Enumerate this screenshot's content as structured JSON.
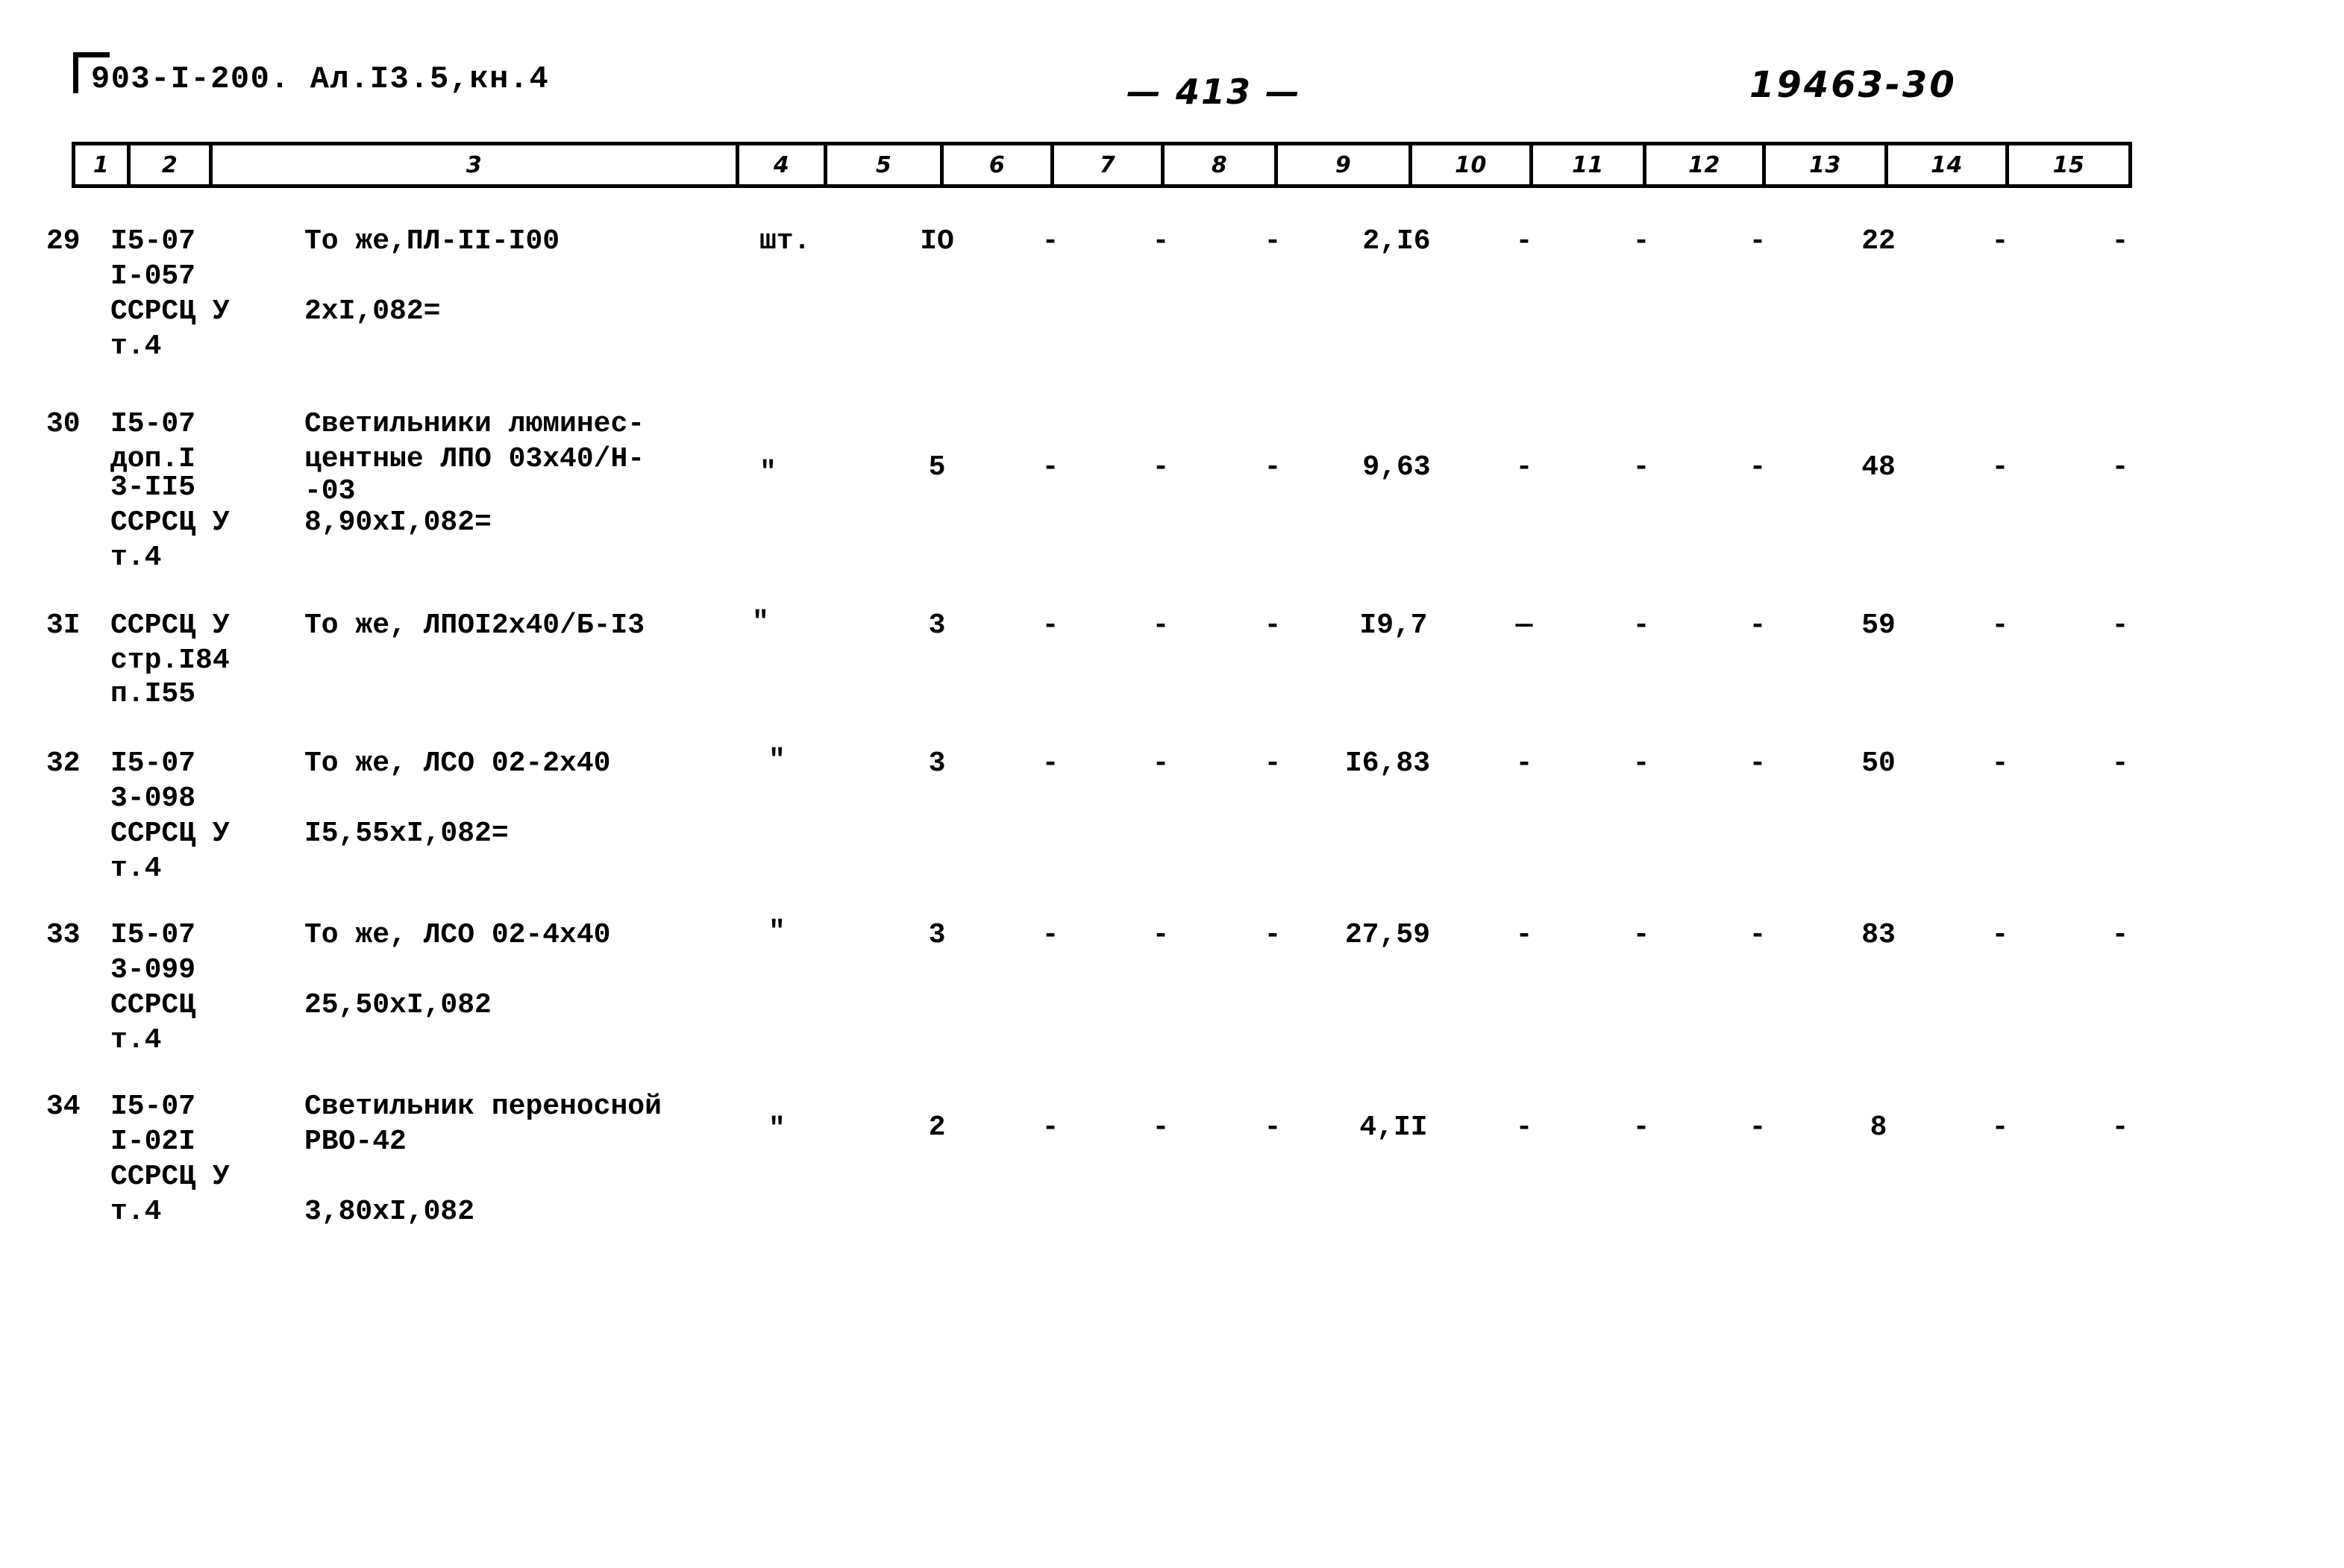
{
  "header": {
    "doc_code": "903-I-200. Ал.I3.5,кн.4",
    "page_number": "— 413 —",
    "archive_code": "19463-30"
  },
  "table": {
    "column_headers": [
      "1",
      "2",
      "3",
      "4",
      "5",
      "6",
      "7",
      "8",
      "9",
      "10",
      "11",
      "12",
      "13",
      "14",
      "15"
    ],
    "rows": [
      {
        "num": "29",
        "code_lines": [
          "I5-07",
          "I-057",
          "ССРСЦ У",
          "т.4"
        ],
        "desc_lines": [
          "То же,ПЛ-II-I00",
          "",
          "2xI,082=",
          ""
        ],
        "unit": "шт.",
        "c5": "IO",
        "c6": "-",
        "c7": "-",
        "c8": "-",
        "c9": "2,I6",
        "c10": "-",
        "c11": "-",
        "c12": "-",
        "c13": "22",
        "c14": "-",
        "c15": "-"
      },
      {
        "num": "30",
        "code_lines": [
          "I5-07",
          "доп.I",
          "3-II5",
          "ССРСЦ У",
          "т.4"
        ],
        "desc_lines": [
          "Светильники люминес-",
          "центные ЛПО 03х40/Н-",
          "-03",
          "8,90хI,082=",
          ""
        ],
        "unit": "\"",
        "c5": "5",
        "c6": "-",
        "c7": "-",
        "c8": "-",
        "c9": "9,63",
        "c10": "-",
        "c11": "-",
        "c12": "-",
        "c13": "48",
        "c14": "-",
        "c15": "-"
      },
      {
        "num": "3I",
        "code_lines": [
          "ССРСЦ У",
          "стр.I84",
          "п.I55"
        ],
        "desc_lines": [
          "То же, ЛПОI2х40/Б-I3",
          "",
          ""
        ],
        "unit": "\"",
        "c5": "3",
        "c6": "-",
        "c7": "-",
        "c8": "-",
        "c9": "I9,7",
        "c10": "—",
        "c11": "-",
        "c12": "-",
        "c13": "59",
        "c14": "-",
        "c15": "-"
      },
      {
        "num": "32",
        "code_lines": [
          "I5-07",
          "3-098",
          "ССРСЦ У",
          "т.4"
        ],
        "desc_lines": [
          "То же, ЛСО 02-2х40",
          "",
          "I5,55хI,082=",
          ""
        ],
        "unit": "\"",
        "c5": "3",
        "c6": "-",
        "c7": "-",
        "c8": "-",
        "c9": "I6,83",
        "c10": "-",
        "c11": "-",
        "c12": "-",
        "c13": "50",
        "c14": "-",
        "c15": "-"
      },
      {
        "num": "33",
        "code_lines": [
          "I5-07",
          "3-099",
          "ССРСЦ",
          "т.4"
        ],
        "desc_lines": [
          "То же, ЛСО 02-4х40",
          "",
          "25,50хI,082",
          ""
        ],
        "unit": "\"",
        "c5": "3",
        "c6": "-",
        "c7": "-",
        "c8": "-",
        "c9": "27,59",
        "c10": "-",
        "c11": "-",
        "c12": "-",
        "c13": "83",
        "c14": "-",
        "c15": "-"
      },
      {
        "num": "34",
        "code_lines": [
          "I5-07",
          "I-02I",
          "ССРСЦ У",
          "т.4"
        ],
        "desc_lines": [
          "Светильник переносной",
          "РВО-42",
          "",
          "3,80хI,082"
        ],
        "unit": "\"",
        "c5": "2",
        "c6": "-",
        "c7": "-",
        "c8": "-",
        "c9": "4,II",
        "c10": "-",
        "c11": "-",
        "c12": "-",
        "c13": "8",
        "c14": "-",
        "c15": "-"
      }
    ]
  }
}
